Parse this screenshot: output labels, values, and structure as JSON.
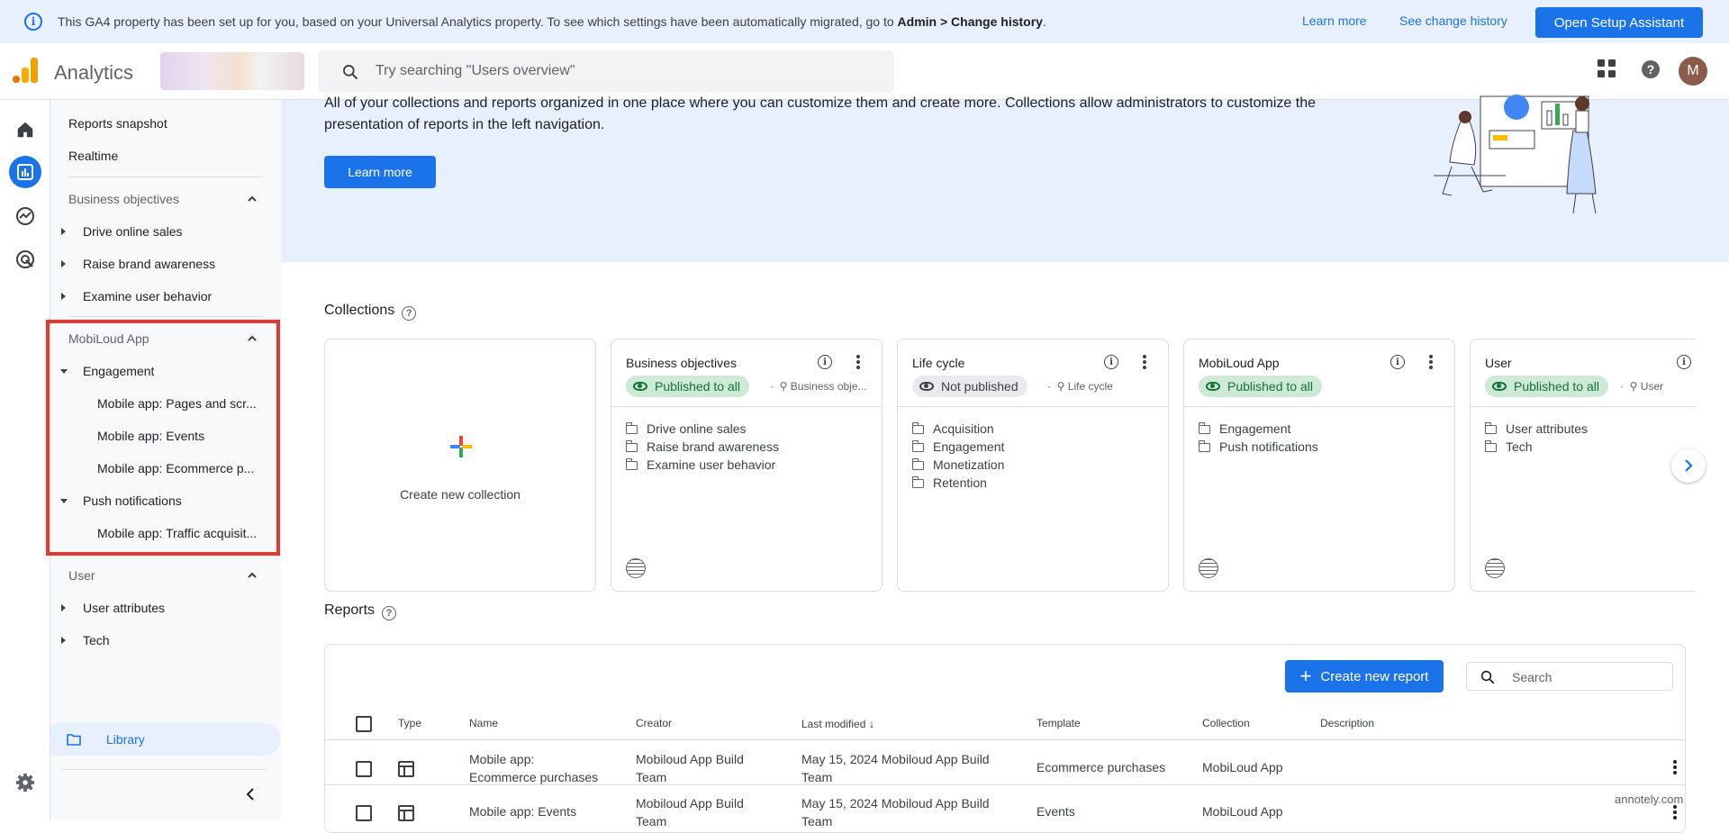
{
  "banner": {
    "message": "This GA4 property has been set up for you, based on your Universal Analytics property. To see which settings have been automatically migrated, go to ",
    "message_bold": "Admin > Change history",
    "message_end": ".",
    "learn_more": "Learn more",
    "see_history": "See change history",
    "setup_button": "Open Setup Assistant"
  },
  "header": {
    "app_name": "Analytics",
    "search_placeholder": "Try searching \"Users overview\"",
    "avatar_letter": "M"
  },
  "sidebar": {
    "top_items": [
      "Reports snapshot",
      "Realtime"
    ],
    "sections": [
      {
        "title": "Business objectives",
        "items": [
          "Drive online sales",
          "Raise brand awareness",
          "Examine user behavior"
        ]
      },
      {
        "title": "MobiLoud App",
        "groups": [
          {
            "label": "Engagement",
            "items": [
              "Mobile app: Pages and scr...",
              "Mobile app: Events",
              "Mobile app: Ecommerce p..."
            ]
          },
          {
            "label": "Push notifications",
            "items": [
              "Mobile app: Traffic acquisit..."
            ]
          }
        ]
      },
      {
        "title": "User",
        "items": [
          "User attributes",
          "Tech"
        ]
      }
    ],
    "library": "Library"
  },
  "hero": {
    "text": "All of your collections and reports organized in one place where you can customize them and create more. Collections allow administrators to customize the presentation of reports in the left navigation.",
    "button": "Learn more"
  },
  "collections": {
    "title": "Collections",
    "create_label": "Create new collection",
    "cards": [
      {
        "title": "Business objectives",
        "status": "Published to all",
        "meta": "Business obje...",
        "folders": [
          "Drive online sales",
          "Raise brand awareness",
          "Examine user behavior"
        ]
      },
      {
        "title": "Life cycle",
        "status": "Not published",
        "meta": "Life cycle",
        "folders": [
          "Acquisition",
          "Engagement",
          "Monetization",
          "Retention"
        ]
      },
      {
        "title": "MobiLoud App",
        "status": "Published to all",
        "meta": "",
        "folders": [
          "Engagement",
          "Push notifications"
        ]
      },
      {
        "title": "User",
        "status": "Published to all",
        "meta": "User",
        "folders": [
          "User attributes",
          "Tech"
        ]
      }
    ]
  },
  "reports": {
    "title": "Reports",
    "create_button": "Create new report",
    "search_placeholder": "Search",
    "columns": [
      "Type",
      "Name",
      "Creator",
      "Last modified",
      "Template",
      "Collection",
      "Description"
    ],
    "rows": [
      {
        "name": "Mobile app: Ecommerce purchases",
        "creator": "Mobiloud App Build Team",
        "modified": "May 15, 2024 Mobiloud App Build Team",
        "template": "Ecommerce purchases",
        "collection": "MobiLoud App"
      },
      {
        "name": "Mobile app: Events",
        "creator": "Mobiloud App Build Team",
        "modified": "May 15, 2024 Mobiloud App Build Team",
        "template": "Events",
        "collection": "MobiLoud App"
      }
    ]
  },
  "watermark": "annotely.com",
  "colors": {
    "accent": "#1a73e8",
    "highlight": "#e53935",
    "published": "#137333"
  }
}
